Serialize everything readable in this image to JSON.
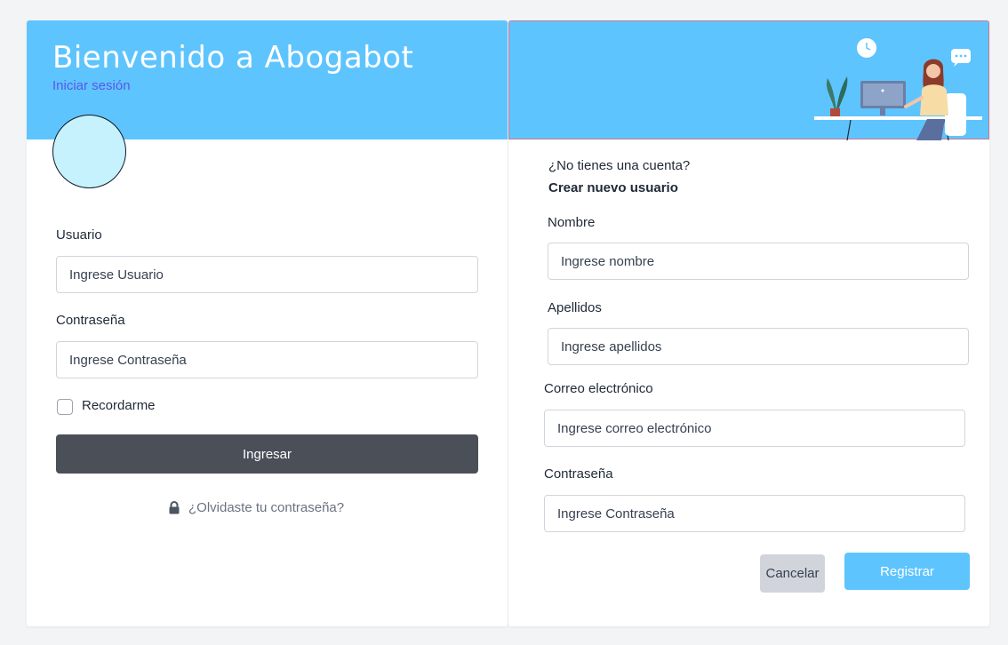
{
  "login": {
    "title": "Bienvenido a Abogabot",
    "subtitle": "Iniciar sesión",
    "username_label": "Usuario",
    "username_placeholder": "Ingrese Usuario",
    "password_label": "Contraseña",
    "password_placeholder": "Ingrese Contraseña",
    "remember_label": "Recordarme",
    "submit_label": "Ingresar",
    "forgot_label": "¿Olvidaste tu contraseña?"
  },
  "signup": {
    "question": "¿No tienes una cuenta?",
    "create_link": "Crear nuevo usuario",
    "name_label": "Nombre",
    "name_placeholder": "Ingrese nombre",
    "lastname_label": "Apellidos",
    "lastname_placeholder": "Ingrese apellidos",
    "email_label": "Correo electrónico",
    "email_placeholder": "Ingrese correo electrónico",
    "password_label": "Contraseña",
    "password_placeholder": "Ingrese Contraseña",
    "cancel_label": "Cancelar",
    "register_label": "Registrar"
  },
  "theme": {
    "header_color": "#5ec4fe",
    "primary_button_color": "#4a4f58",
    "subtitle_color": "#5a57e8",
    "avatar_color": "#c6f2fe"
  },
  "icons": {
    "lock": "lock-icon",
    "illustration": "office-worker-illustration"
  }
}
